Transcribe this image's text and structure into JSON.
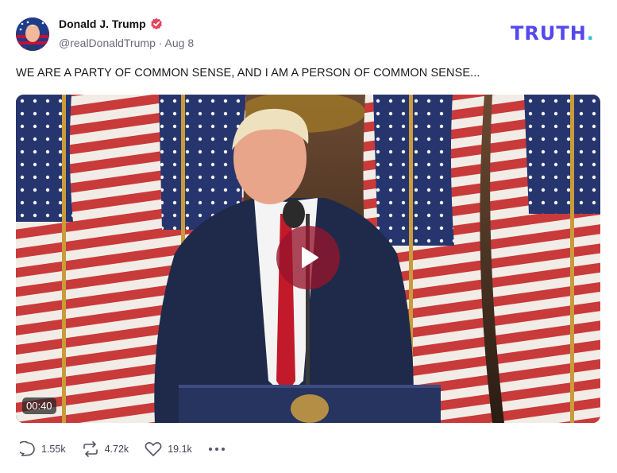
{
  "author": {
    "display_name": "Donald J. Trump",
    "handle": "@realDonaldTrump",
    "separator": "·",
    "date": "Aug 8",
    "avatar_icon": "avatar-flag-portrait",
    "verified_icon": "verified-badge-icon"
  },
  "brand": {
    "logo_text": "TRUTH",
    "logo_dot": ".",
    "logo_color": "#5448ee",
    "dot_color": "#29c3d8"
  },
  "post": {
    "text": "WE ARE A PARTY OF COMMON SENSE, AND I AM A PERSON OF COMMON SENSE..."
  },
  "media": {
    "type": "video",
    "duration": "00:40",
    "play_icon": "play-icon",
    "play_button_color": "#96142d"
  },
  "actions": {
    "replies": "1.55k",
    "retruths": "4.72k",
    "likes": "19.1k",
    "reply_icon": "reply-icon",
    "retruth_icon": "retruth-icon",
    "like_icon": "heart-icon",
    "more_icon": "more-icon"
  }
}
